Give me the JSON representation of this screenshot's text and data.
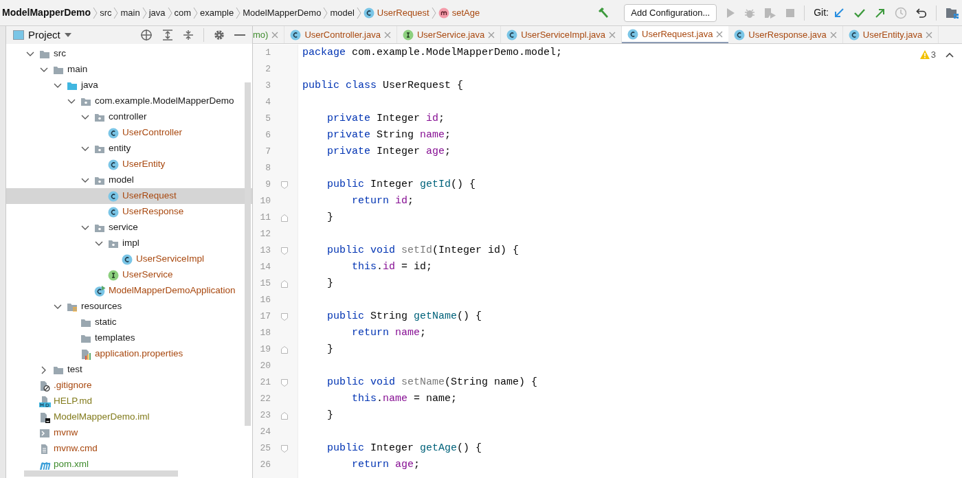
{
  "breadcrumbs": [
    {
      "label": "ModelMapperDemo",
      "kind": "project"
    },
    {
      "label": "src",
      "kind": "folder"
    },
    {
      "label": "main",
      "kind": "folder"
    },
    {
      "label": "java",
      "kind": "folder"
    },
    {
      "label": "com",
      "kind": "folder"
    },
    {
      "label": "example",
      "kind": "folder"
    },
    {
      "label": "ModelMapperDemo",
      "kind": "folder"
    },
    {
      "label": "model",
      "kind": "folder"
    },
    {
      "label": "UserRequest",
      "kind": "class"
    },
    {
      "label": "setAge",
      "kind": "method"
    }
  ],
  "toolbar": {
    "run_config": "Add Configuration...",
    "vcs_label": "Git:"
  },
  "project_panel": {
    "title": "Project"
  },
  "tree": [
    {
      "label": "src",
      "kind": "folder",
      "expanded": true,
      "selected": false,
      "children": [
        {
          "label": "main",
          "kind": "folder",
          "expanded": true,
          "selected": false,
          "children": [
            {
              "label": "java",
              "kind": "source-folder",
              "expanded": true,
              "selected": false,
              "children": [
                {
                  "label": "com.example.ModelMapperDemo",
                  "kind": "package",
                  "expanded": true,
                  "selected": false,
                  "children": [
                    {
                      "label": "controller",
                      "kind": "package",
                      "expanded": true,
                      "selected": false,
                      "children": [
                        {
                          "label": "UserController",
                          "kind": "class",
                          "color": "#a8480f",
                          "selected": false
                        }
                      ]
                    },
                    {
                      "label": "entity",
                      "kind": "package",
                      "expanded": true,
                      "selected": false,
                      "children": [
                        {
                          "label": "UserEntity",
                          "kind": "class",
                          "color": "#a8480f",
                          "selected": false
                        }
                      ]
                    },
                    {
                      "label": "model",
                      "kind": "package",
                      "expanded": true,
                      "selected": false,
                      "children": [
                        {
                          "label": "UserRequest",
                          "kind": "class",
                          "color": "#a8480f",
                          "selected": true
                        },
                        {
                          "label": "UserResponse",
                          "kind": "class",
                          "color": "#a8480f",
                          "selected": false
                        }
                      ]
                    },
                    {
                      "label": "service",
                      "kind": "package",
                      "expanded": true,
                      "selected": false,
                      "children": [
                        {
                          "label": "impl",
                          "kind": "package",
                          "expanded": true,
                          "selected": false,
                          "children": [
                            {
                              "label": "UserServiceImpl",
                              "kind": "class",
                              "color": "#a8480f",
                              "selected": false
                            }
                          ]
                        },
                        {
                          "label": "UserService",
                          "kind": "interface",
                          "color": "#a8480f",
                          "selected": false
                        }
                      ]
                    },
                    {
                      "label": "ModelMapperDemoApplication",
                      "kind": "app-class",
                      "color": "#a8480f",
                      "selected": false
                    }
                  ]
                }
              ]
            },
            {
              "label": "resources",
              "kind": "resources-folder",
              "expanded": true,
              "selected": false,
              "children": [
                {
                  "label": "static",
                  "kind": "folder",
                  "selected": false
                },
                {
                  "label": "templates",
                  "kind": "folder",
                  "selected": false
                },
                {
                  "label": "application.properties",
                  "kind": "properties",
                  "color": "#a8480f",
                  "selected": false
                }
              ]
            }
          ]
        },
        {
          "label": "test",
          "kind": "folder",
          "expanded": false,
          "selected": false
        }
      ]
    },
    {
      "label": ".gitignore",
      "kind": "gitignore",
      "color": "#a8480f",
      "selected": false
    },
    {
      "label": "HELP.md",
      "kind": "markdown",
      "color": "#827b1c",
      "selected": false
    },
    {
      "label": "ModelMapperDemo.iml",
      "kind": "iml",
      "color": "#827b1c",
      "selected": false
    },
    {
      "label": "mvnw",
      "kind": "script",
      "color": "#a8480f",
      "selected": false
    },
    {
      "label": "mvnw.cmd",
      "kind": "text-file",
      "color": "#a8480f",
      "selected": false
    },
    {
      "label": "pom.xml",
      "kind": "maven",
      "color": "#3d8a2b",
      "selected": false
    }
  ],
  "tabs": [
    {
      "label": "mo)",
      "kind": "partial",
      "color": "#3d8a2b",
      "selected": false
    },
    {
      "label": "UserController.java",
      "kind": "class",
      "color": "#a8480f",
      "selected": false
    },
    {
      "label": "UserService.java",
      "kind": "interface",
      "color": "#a8480f",
      "selected": false
    },
    {
      "label": "UserServiceImpl.java",
      "kind": "class",
      "color": "#a8480f",
      "selected": false
    },
    {
      "label": "UserRequest.java",
      "kind": "class",
      "color": "#a8480f",
      "selected": true
    },
    {
      "label": "UserResponse.java",
      "kind": "class",
      "color": "#a8480f",
      "selected": false
    },
    {
      "label": "UserEntity.java",
      "kind": "class",
      "color": "#a8480f",
      "selected": false
    }
  ],
  "inspections": {
    "warnings": "3"
  },
  "code": [
    {
      "number": "1",
      "tokens": [
        {
          "kind": "keyword",
          "text": "package",
          "space": true
        },
        {
          "kind": "plain",
          "text": "com.example.ModelMapperDemo.model;"
        }
      ]
    },
    {
      "number": "2"
    },
    {
      "number": "3",
      "tokens": [
        {
          "kind": "keyword",
          "text": "public class",
          "space": true
        },
        {
          "kind": "plain",
          "text": "UserRequest {"
        }
      ]
    },
    {
      "number": "4"
    },
    {
      "number": "5",
      "tokens": [
        {
          "kind": "keyword",
          "text": "private",
          "space": true
        },
        {
          "kind": "plain",
          "text": "Integer",
          "space": true
        },
        {
          "kind": "field",
          "text": "id"
        },
        {
          "kind": "plain",
          "text": ";"
        }
      ]
    },
    {
      "number": "6",
      "tokens": [
        {
          "kind": "keyword",
          "text": "private",
          "space": true
        },
        {
          "kind": "plain",
          "text": "String",
          "space": true
        },
        {
          "kind": "field",
          "text": "name"
        },
        {
          "kind": "plain",
          "text": ";"
        }
      ]
    },
    {
      "number": "7",
      "tokens": [
        {
          "kind": "keyword",
          "text": "private",
          "space": true
        },
        {
          "kind": "plain",
          "text": "Integer",
          "space": true
        },
        {
          "kind": "field",
          "text": "age"
        },
        {
          "kind": "plain",
          "text": ";"
        }
      ]
    },
    {
      "number": "8"
    },
    {
      "number": "9",
      "fold_start": true,
      "tokens": [
        {
          "kind": "keyword",
          "text": "public",
          "space": true
        },
        {
          "kind": "plain",
          "text": "Integer",
          "space": true
        },
        {
          "kind": "method",
          "text": "getId"
        },
        {
          "kind": "plain",
          "text": "() {"
        }
      ]
    },
    {
      "number": "10",
      "tokens": [
        {
          "kind": "keyword",
          "text": "return",
          "space": true
        },
        {
          "kind": "field",
          "text": "id"
        },
        {
          "kind": "plain",
          "text": ";"
        }
      ]
    },
    {
      "number": "11",
      "fold_end": true,
      "tokens": [
        {
          "kind": "plain",
          "text": "}"
        }
      ]
    },
    {
      "number": "12"
    },
    {
      "number": "13",
      "fold_start": true,
      "tokens": [
        {
          "kind": "keyword",
          "text": "public void",
          "space": true
        },
        {
          "kind": "unused",
          "text": "setId"
        },
        {
          "kind": "plain",
          "text": "(Integer id) {"
        }
      ]
    },
    {
      "number": "14",
      "tokens": [
        {
          "kind": "keyword",
          "text": "this"
        },
        {
          "kind": "plain",
          "text": "."
        },
        {
          "kind": "field",
          "text": "id",
          "space": true
        },
        {
          "kind": "plain",
          "text": "= id;"
        }
      ]
    },
    {
      "number": "15",
      "fold_end": true,
      "tokens": [
        {
          "kind": "plain",
          "text": "}"
        }
      ]
    },
    {
      "number": "16"
    },
    {
      "number": "17",
      "fold_start": true,
      "tokens": [
        {
          "kind": "keyword",
          "text": "public",
          "space": true
        },
        {
          "kind": "plain",
          "text": "String",
          "space": true
        },
        {
          "kind": "method",
          "text": "getName"
        },
        {
          "kind": "plain",
          "text": "() {"
        }
      ]
    },
    {
      "number": "18",
      "tokens": [
        {
          "kind": "keyword",
          "text": "return",
          "space": true
        },
        {
          "kind": "field",
          "text": "name"
        },
        {
          "kind": "plain",
          "text": ";"
        }
      ]
    },
    {
      "number": "19",
      "fold_end": true,
      "tokens": [
        {
          "kind": "plain",
          "text": "}"
        }
      ]
    },
    {
      "number": "20"
    },
    {
      "number": "21",
      "fold_start": true,
      "tokens": [
        {
          "kind": "keyword",
          "text": "public void",
          "space": true
        },
        {
          "kind": "unused",
          "text": "setName"
        },
        {
          "kind": "plain",
          "text": "(String name) {"
        }
      ]
    },
    {
      "number": "22",
      "tokens": [
        {
          "kind": "keyword",
          "text": "this"
        },
        {
          "kind": "plain",
          "text": "."
        },
        {
          "kind": "field",
          "text": "name",
          "space": true
        },
        {
          "kind": "plain",
          "text": "= name;"
        }
      ]
    },
    {
      "number": "23",
      "fold_end": true,
      "tokens": [
        {
          "kind": "plain",
          "text": "}"
        }
      ]
    },
    {
      "number": "24"
    },
    {
      "number": "25",
      "fold_start": true,
      "tokens": [
        {
          "kind": "keyword",
          "text": "public",
          "space": true
        },
        {
          "kind": "plain",
          "text": "Integer",
          "space": true
        },
        {
          "kind": "method",
          "text": "getAge"
        },
        {
          "kind": "plain",
          "text": "() {"
        }
      ]
    },
    {
      "number": "26",
      "tokens": [
        {
          "kind": "keyword",
          "text": "return",
          "space": true
        },
        {
          "kind": "field",
          "text": "age"
        },
        {
          "kind": "plain",
          "text": ";"
        }
      ]
    }
  ]
}
